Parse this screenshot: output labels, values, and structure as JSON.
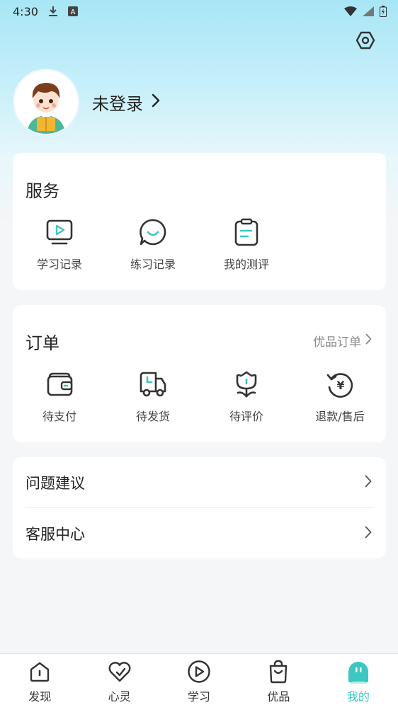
{
  "status_bar": {
    "time": "4:30"
  },
  "profile": {
    "login_text": "未登录"
  },
  "services": {
    "title": "服务",
    "items": [
      {
        "label": "学习记录",
        "icon": "tv-play-icon"
      },
      {
        "label": "练习记录",
        "icon": "chat-smile-icon"
      },
      {
        "label": "我的测评",
        "icon": "clipboard-icon"
      }
    ]
  },
  "orders": {
    "title": "订单",
    "more_label": "优品订单",
    "items": [
      {
        "label": "待支付",
        "icon": "wallet-icon"
      },
      {
        "label": "待发货",
        "icon": "truck-icon"
      },
      {
        "label": "待评价",
        "icon": "tulip-icon"
      },
      {
        "label": "退款/售后",
        "icon": "refund-yen-icon"
      }
    ]
  },
  "menu": {
    "feedback_label": "问题建议",
    "customer_service_label": "客服中心"
  },
  "bottom_nav": {
    "items": [
      {
        "label": "发现",
        "icon": "home-icon"
      },
      {
        "label": "心灵",
        "icon": "heart-icon"
      },
      {
        "label": "学习",
        "icon": "play-circle-icon"
      },
      {
        "label": "优品",
        "icon": "shopping-bag-icon"
      },
      {
        "label": "我的",
        "icon": "mine-face-icon"
      }
    ],
    "active_index": 4,
    "active_color": "#3cc7c0"
  },
  "colors": {
    "accent": "#3cc7c0",
    "card_bg": "#ffffff",
    "page_bg": "#f5f6f8"
  }
}
